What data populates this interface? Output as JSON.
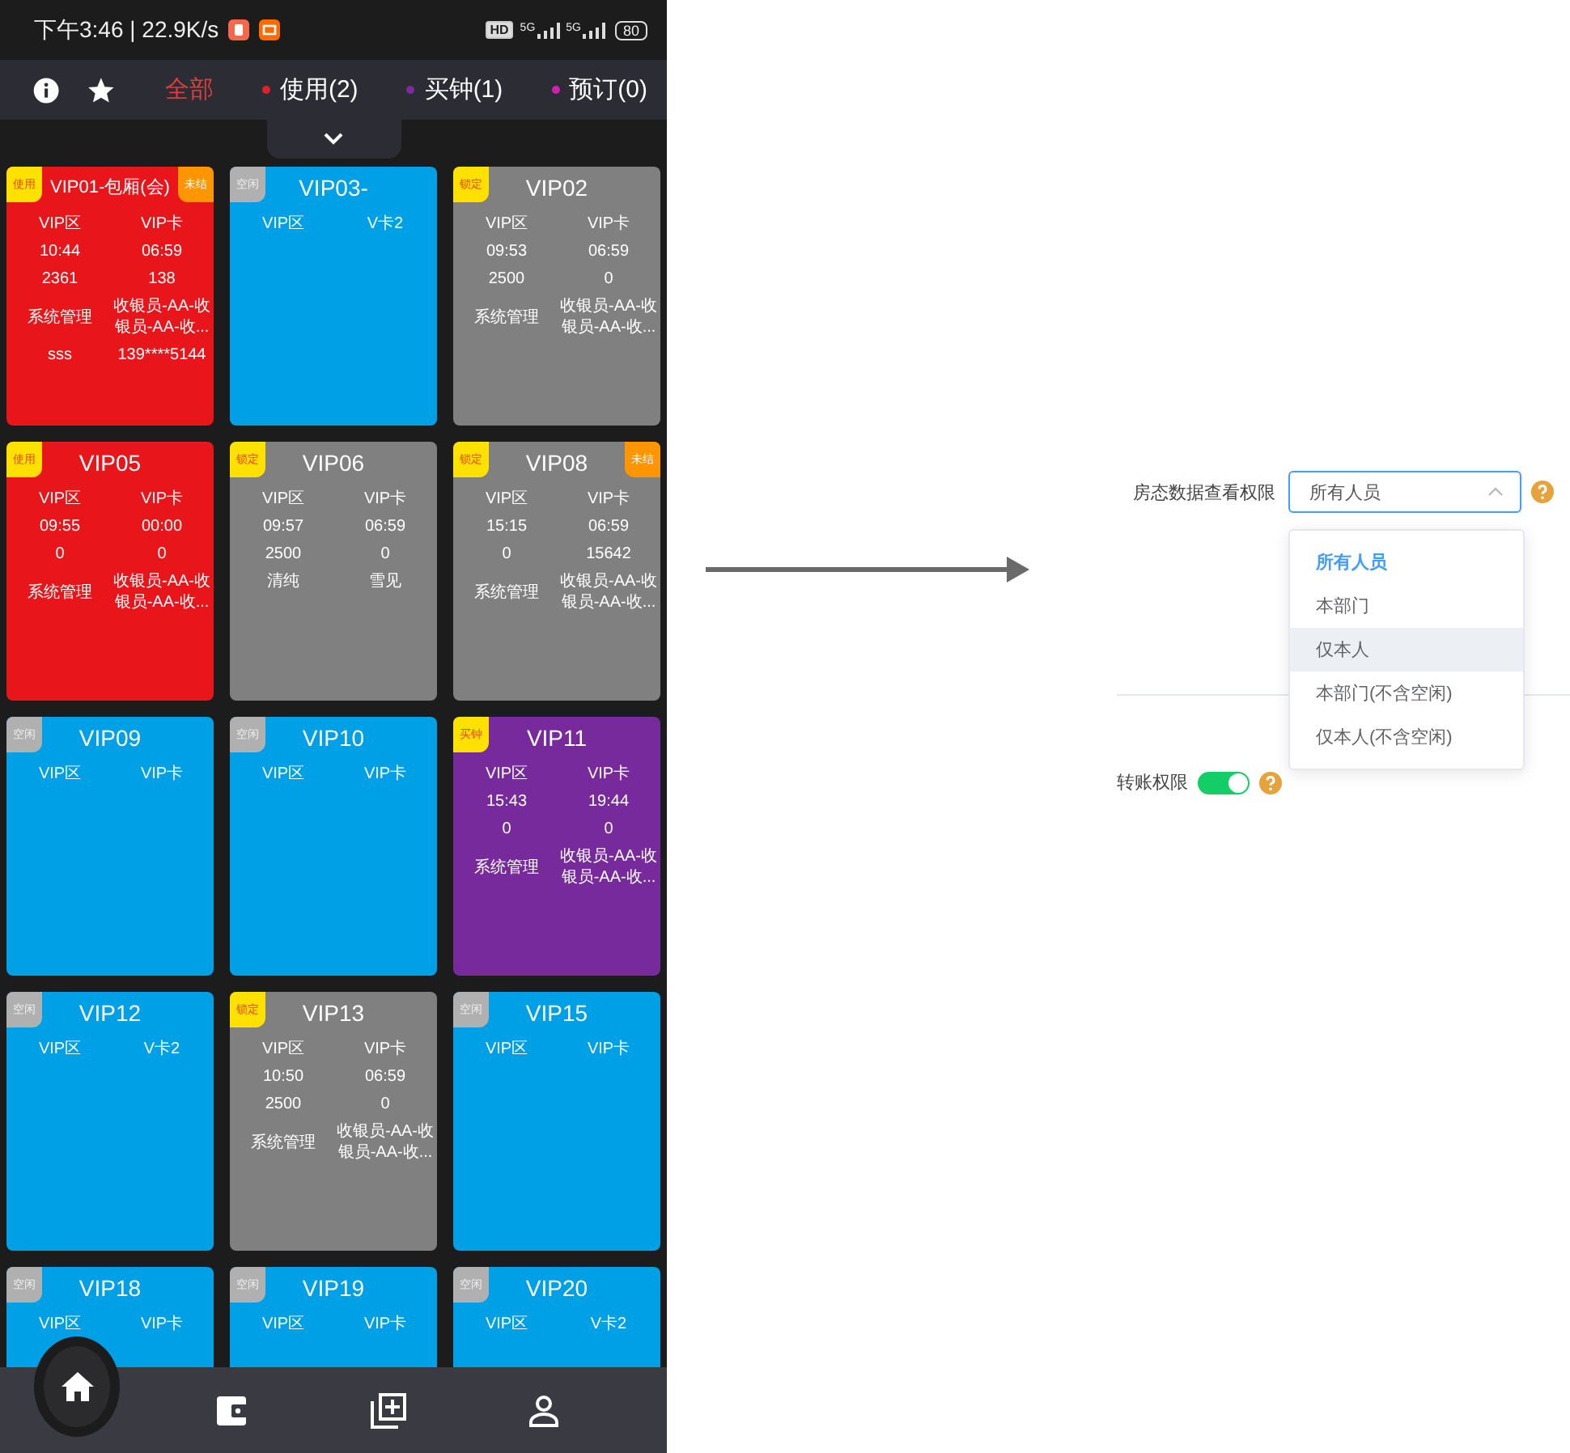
{
  "status_bar": {
    "time": "下午3:46 | 22.9K/s",
    "hd": "HD",
    "signals": [
      "5G",
      "5G"
    ],
    "battery": "80"
  },
  "filter_tabs": [
    {
      "label": "全部",
      "selected": true
    },
    {
      "label": "使用(2)",
      "selected": false,
      "color": "#e0202a"
    },
    {
      "label": "买钟(1)",
      "selected": false,
      "color": "#7b2aa0"
    },
    {
      "label": "预订(0)",
      "selected": false,
      "color": "#d020b0"
    }
  ],
  "rooms": [
    {
      "title": "VIP01-包厢(会)",
      "kind": "use",
      "badge": "使用",
      "flag": "未结",
      "rows": [
        [
          "VIP区",
          "VIP卡"
        ],
        [
          "10:44",
          "06:59"
        ],
        [
          "2361",
          "138"
        ],
        [
          "系统管理",
          "收银员-AA-收银员-AA-收..."
        ],
        [
          "sss",
          "139****5144"
        ]
      ]
    },
    {
      "title": "VIP03-",
      "kind": "idle",
      "badge": "空闲",
      "rows": [
        [
          "VIP区",
          "V卡2"
        ]
      ]
    },
    {
      "title": "VIP02",
      "kind": "lock",
      "badge": "锁定",
      "rows": [
        [
          "VIP区",
          "VIP卡"
        ],
        [
          "09:53",
          "06:59"
        ],
        [
          "2500",
          "0"
        ],
        [
          "系统管理",
          "收银员-AA-收银员-AA-收..."
        ]
      ]
    },
    {
      "title": "VIP05",
      "kind": "use",
      "badge": "使用",
      "rows": [
        [
          "VIP区",
          "VIP卡"
        ],
        [
          "09:55",
          "00:00"
        ],
        [
          "0",
          "0"
        ],
        [
          "系统管理",
          "收银员-AA-收银员-AA-收..."
        ]
      ]
    },
    {
      "title": "VIP06",
      "kind": "lock",
      "badge": "锁定",
      "rows": [
        [
          "VIP区",
          "VIP卡"
        ],
        [
          "09:57",
          "06:59"
        ],
        [
          "2500",
          "0"
        ],
        [
          "清纯",
          "雪见"
        ]
      ]
    },
    {
      "title": "VIP08",
      "kind": "lock",
      "badge": "锁定",
      "flag": "未结",
      "rows": [
        [
          "VIP区",
          "VIP卡"
        ],
        [
          "15:15",
          "06:59"
        ],
        [
          "0",
          "15642"
        ],
        [
          "系统管理",
          "收银员-AA-收银员-AA-收..."
        ]
      ]
    },
    {
      "title": "VIP09",
      "kind": "idle",
      "badge": "空闲",
      "rows": [
        [
          "VIP区",
          "VIP卡"
        ]
      ]
    },
    {
      "title": "VIP10",
      "kind": "idle",
      "badge": "空闲",
      "rows": [
        [
          "VIP区",
          "VIP卡"
        ]
      ]
    },
    {
      "title": "VIP11",
      "kind": "buy",
      "badge": "买钟",
      "rows": [
        [
          "VIP区",
          "VIP卡"
        ],
        [
          "15:43",
          "19:44"
        ],
        [
          "0",
          "0"
        ],
        [
          "系统管理",
          "收银员-AA-收银员-AA-收..."
        ]
      ]
    },
    {
      "title": "VIP12",
      "kind": "idle",
      "badge": "空闲",
      "rows": [
        [
          "VIP区",
          "V卡2"
        ]
      ]
    },
    {
      "title": "VIP13",
      "kind": "lock",
      "badge": "锁定",
      "rows": [
        [
          "VIP区",
          "VIP卡"
        ],
        [
          "10:50",
          "06:59"
        ],
        [
          "2500",
          "0"
        ],
        [
          "系统管理",
          "收银员-AA-收银员-AA-收..."
        ]
      ]
    },
    {
      "title": "VIP15",
      "kind": "idle",
      "badge": "空闲",
      "rows": [
        [
          "VIP区",
          "VIP卡"
        ]
      ]
    },
    {
      "title": "VIP18",
      "kind": "idle",
      "badge": "空闲",
      "rows": [
        [
          "VIP区",
          "VIP卡"
        ]
      ]
    },
    {
      "title": "VIP19",
      "kind": "idle",
      "badge": "空闲",
      "rows": [
        [
          "VIP区",
          "VIP卡"
        ]
      ]
    },
    {
      "title": "VIP20",
      "kind": "idle",
      "badge": "空闲",
      "rows": [
        [
          "VIP区",
          "V卡2"
        ]
      ]
    }
  ],
  "bottom_nav": [
    {
      "kind": "home",
      "selected": true
    },
    {
      "kind": "wallet",
      "selected": false
    },
    {
      "kind": "add",
      "selected": false
    },
    {
      "kind": "person",
      "selected": false
    }
  ],
  "settings": {
    "view_permission": {
      "label": "房态数据查看权限",
      "value": "所有人员",
      "expanded": true,
      "options": [
        {
          "label": "所有人员",
          "selected": true,
          "hovered": false
        },
        {
          "label": "本部门",
          "selected": false,
          "hovered": false
        },
        {
          "label": "仅本人",
          "selected": false,
          "hovered": true
        },
        {
          "label": "本部门(不含空闲)",
          "selected": false,
          "hovered": false
        },
        {
          "label": "仅本人(不含空闲)",
          "selected": false,
          "hovered": false
        }
      ]
    },
    "transfer_permission": {
      "label": "转账权限",
      "on": true
    }
  }
}
